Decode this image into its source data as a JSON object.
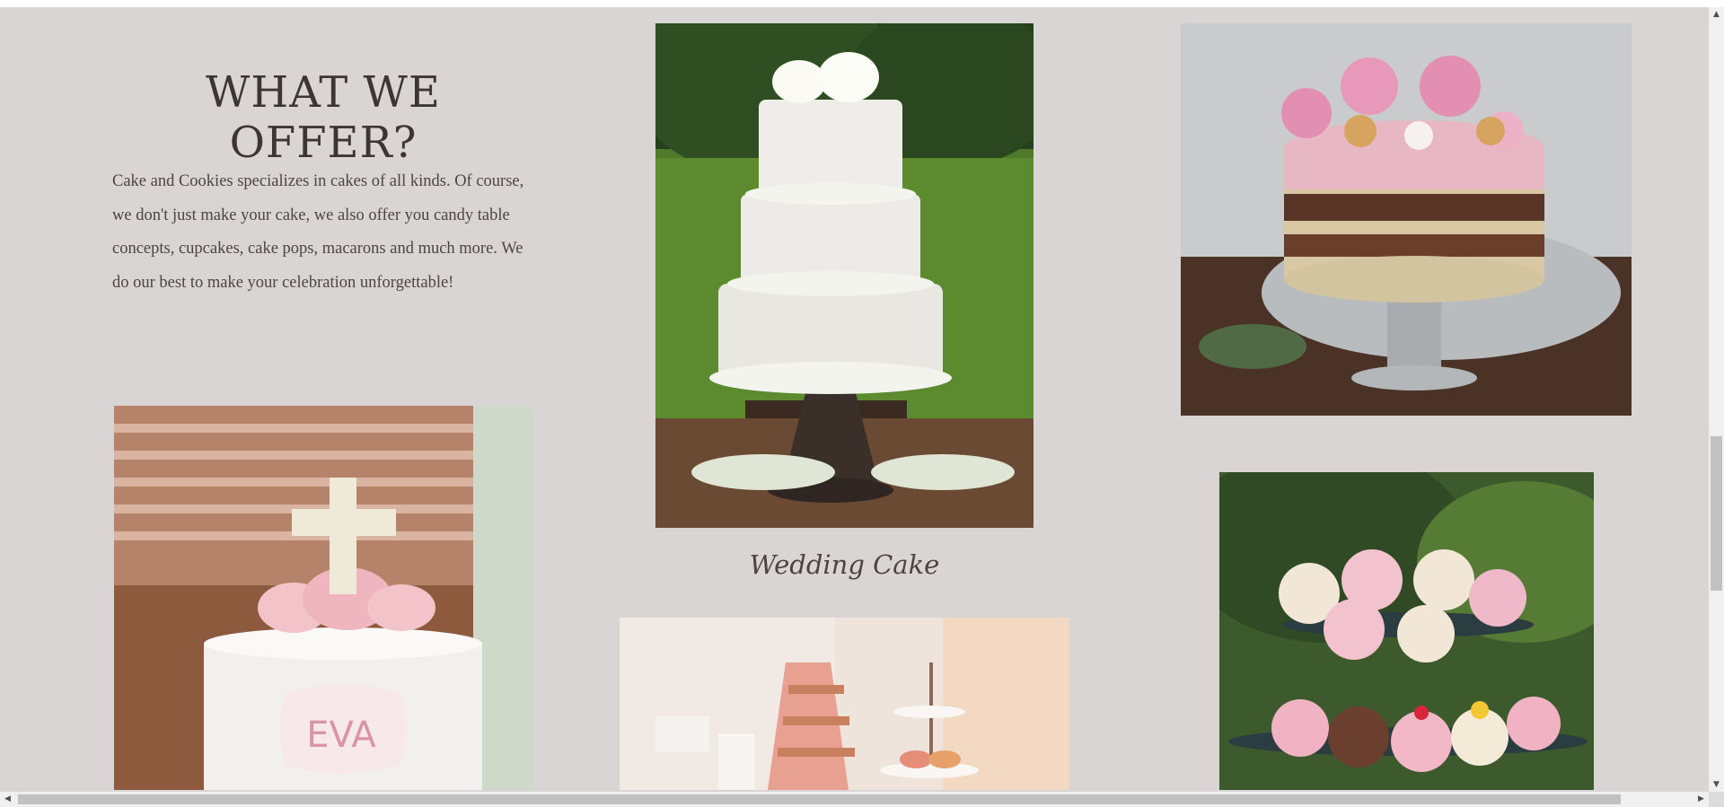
{
  "section": {
    "heading": "WHAT WE OFFER?",
    "intro": "Cake and Cookies specializes in cakes of all kinds. Of course, we don't just make your cake, we also offer you candy table concepts, cupcakes, cake pops, macarons and much more. We do our best to make your celebration unforgettable!"
  },
  "gallery": {
    "wedding_caption": "Wedding Cake"
  },
  "colors": {
    "page_background": "#d9d5d5",
    "heading_text": "#3b3535",
    "body_text": "#4b4545"
  },
  "scrollbars": {
    "up_icon": "▲",
    "down_icon": "▼",
    "left_icon": "◀",
    "right_icon": "▶"
  }
}
